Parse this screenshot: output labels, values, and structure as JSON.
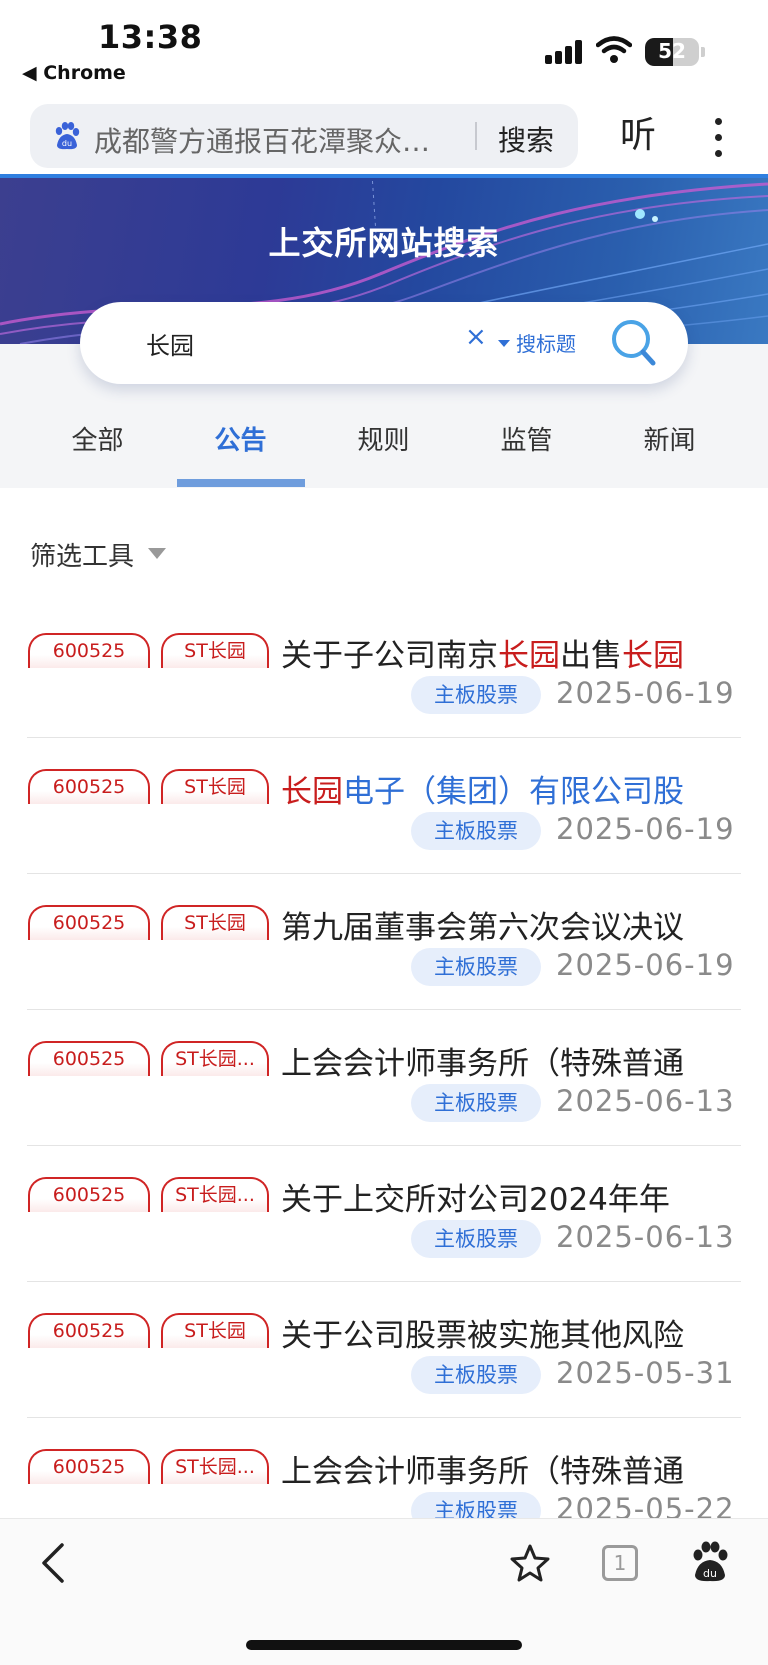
{
  "status": {
    "time": "13:38",
    "back_app": "◀ Chrome",
    "battery": "52",
    "battery_level": 0.52
  },
  "address_bar": {
    "query": "成都警方通报百花潭聚众…",
    "search_label": "搜索",
    "listen_label": "听"
  },
  "banner": {
    "title": "上交所网站搜索"
  },
  "search": {
    "value": "长园",
    "clear": "×",
    "scope": "搜标题"
  },
  "tabs": [
    {
      "label": "全部",
      "active": false
    },
    {
      "label": "公告",
      "active": true
    },
    {
      "label": "规则",
      "active": false
    },
    {
      "label": "监管",
      "active": false
    },
    {
      "label": "新闻",
      "active": false
    }
  ],
  "filter": {
    "label": "筛选工具"
  },
  "results": [
    {
      "code": "600525",
      "name": "ST长园",
      "title": [
        {
          "t": "关于子公司南京",
          "c": "n"
        },
        {
          "t": "长园",
          "c": "hl"
        },
        {
          "t": "出售",
          "c": "n"
        },
        {
          "t": "长园",
          "c": "hl"
        }
      ],
      "board": "主板股票",
      "date": "2025-06-19"
    },
    {
      "code": "600525",
      "name": "ST长园",
      "title": [
        {
          "t": "长园",
          "c": "hl"
        },
        {
          "t": "电子（集团）有限公司股",
          "c": "lk"
        }
      ],
      "board": "主板股票",
      "date": "2025-06-19"
    },
    {
      "code": "600525",
      "name": "ST长园",
      "title": [
        {
          "t": "第九届董事会第六次会议决议",
          "c": "n"
        }
      ],
      "board": "主板股票",
      "date": "2025-06-19"
    },
    {
      "code": "600525",
      "name": "ST长园...",
      "title": [
        {
          "t": "上会会计师事务所（特殊普通",
          "c": "n"
        }
      ],
      "board": "主板股票",
      "date": "2025-06-13"
    },
    {
      "code": "600525",
      "name": "ST长园...",
      "title": [
        {
          "t": "关于上交所对公司2024年年",
          "c": "n"
        }
      ],
      "board": "主板股票",
      "date": "2025-06-13"
    },
    {
      "code": "600525",
      "name": "ST长园",
      "title": [
        {
          "t": "关于公司股票被实施其他风险",
          "c": "n"
        }
      ],
      "board": "主板股票",
      "date": "2025-05-31"
    },
    {
      "code": "600525",
      "name": "ST长园...",
      "title": [
        {
          "t": "上会会计师事务所（特殊普通",
          "c": "n"
        }
      ],
      "board": "主板股票",
      "date": "2025-05-22"
    }
  ],
  "toolbar": {
    "tab_count": "1"
  },
  "colors": {
    "accent": "#2f6fd6",
    "highlight": "#c81d1d",
    "tag_bg": "#e6eefb"
  }
}
